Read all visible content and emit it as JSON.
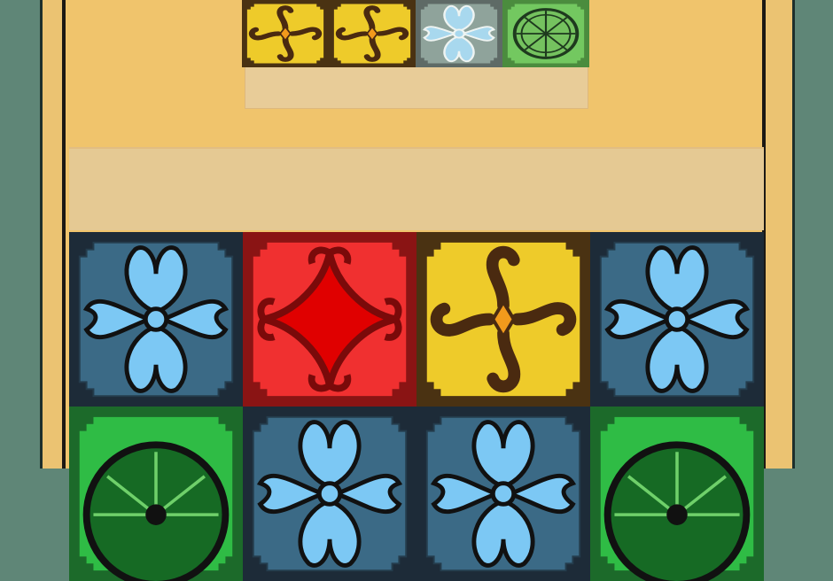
{
  "colors": {
    "sidebar": "#5f8677",
    "board_bg": "#f0c46c",
    "tray": "#e8cc98",
    "blue_tile": "#3b6a86",
    "red_tile": "#f03030",
    "yellow_tile": "#eecb2a",
    "green_tile": "#2fbc45",
    "gray_tile": "#8fa39b",
    "lightgreen_tile": "#73c860"
  },
  "next_piece": [
    {
      "type": "yellow-cross",
      "icon": "yellow-cross-icon"
    },
    {
      "type": "yellow-cross",
      "icon": "yellow-cross-icon"
    },
    {
      "type": "gray-butterfly",
      "icon": "gray-butterfly-icon"
    },
    {
      "type": "green-citrus",
      "icon": "green-citrus-icon"
    }
  ],
  "grid": [
    [
      {
        "type": "blue-butterfly",
        "icon": "blue-butterfly-icon"
      },
      {
        "type": "red-diamond",
        "icon": "red-diamond-icon"
      },
      {
        "type": "yellow-cross",
        "icon": "yellow-cross-icon"
      },
      {
        "type": "blue-butterfly",
        "icon": "blue-butterfly-icon"
      }
    ],
    [
      {
        "type": "green-citrus",
        "icon": "green-citrus-icon"
      },
      {
        "type": "blue-butterfly",
        "icon": "blue-butterfly-icon"
      },
      {
        "type": "blue-butterfly",
        "icon": "blue-butterfly-icon"
      },
      {
        "type": "green-citrus",
        "icon": "green-citrus-icon"
      }
    ]
  ]
}
